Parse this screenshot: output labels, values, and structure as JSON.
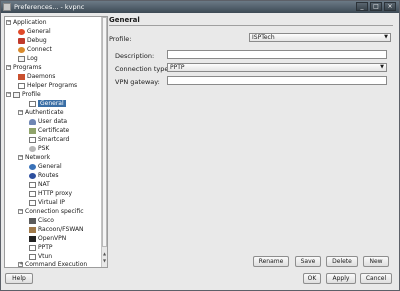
{
  "window": {
    "title": "Preferences... - kvpnc"
  },
  "tree": {
    "items": [
      {
        "label": "Application",
        "toggle": "−"
      },
      {
        "label": "General"
      },
      {
        "label": "Debug"
      },
      {
        "label": "Connect"
      },
      {
        "label": "Log"
      },
      {
        "label": "Programs",
        "toggle": "−"
      },
      {
        "label": "Daemons"
      },
      {
        "label": "Helper Programs"
      },
      {
        "label": "Profile",
        "toggle": "−"
      },
      {
        "label": "General"
      },
      {
        "label": "Authenticate",
        "toggle": "−"
      },
      {
        "label": "User data"
      },
      {
        "label": "Certificate"
      },
      {
        "label": "Smartcard"
      },
      {
        "label": "PSK"
      },
      {
        "label": "Network",
        "toggle": "−"
      },
      {
        "label": "General"
      },
      {
        "label": "Routes"
      },
      {
        "label": "NAT"
      },
      {
        "label": "HTTP proxy"
      },
      {
        "label": "Virtual IP"
      },
      {
        "label": "Connection specific",
        "toggle": "−"
      },
      {
        "label": "Cisco"
      },
      {
        "label": "Racoon/FSWAN"
      },
      {
        "label": "OpenVPN"
      },
      {
        "label": "PPTP"
      },
      {
        "label": "Vtun"
      },
      {
        "label": "Command Execution",
        "toggle": "+"
      }
    ]
  },
  "content": {
    "header": "General",
    "profile_label": "Profile:",
    "profile_value": "ISPTech",
    "description_label": "Description:",
    "connection_type_label": "Connection type:",
    "connection_type_value": "PPTP",
    "vpn_gateway_label": "VPN gateway:",
    "rename_label": "Rename",
    "save_label": "Save",
    "delete_label": "Delete",
    "new_label": "New"
  },
  "footer": {
    "help_label": "Help",
    "ok_label": "OK",
    "apply_label": "Apply",
    "cancel_label": "Cancel"
  },
  "colors": {
    "selection": "#3a6ea5",
    "titlebar": "#3d4a55"
  }
}
